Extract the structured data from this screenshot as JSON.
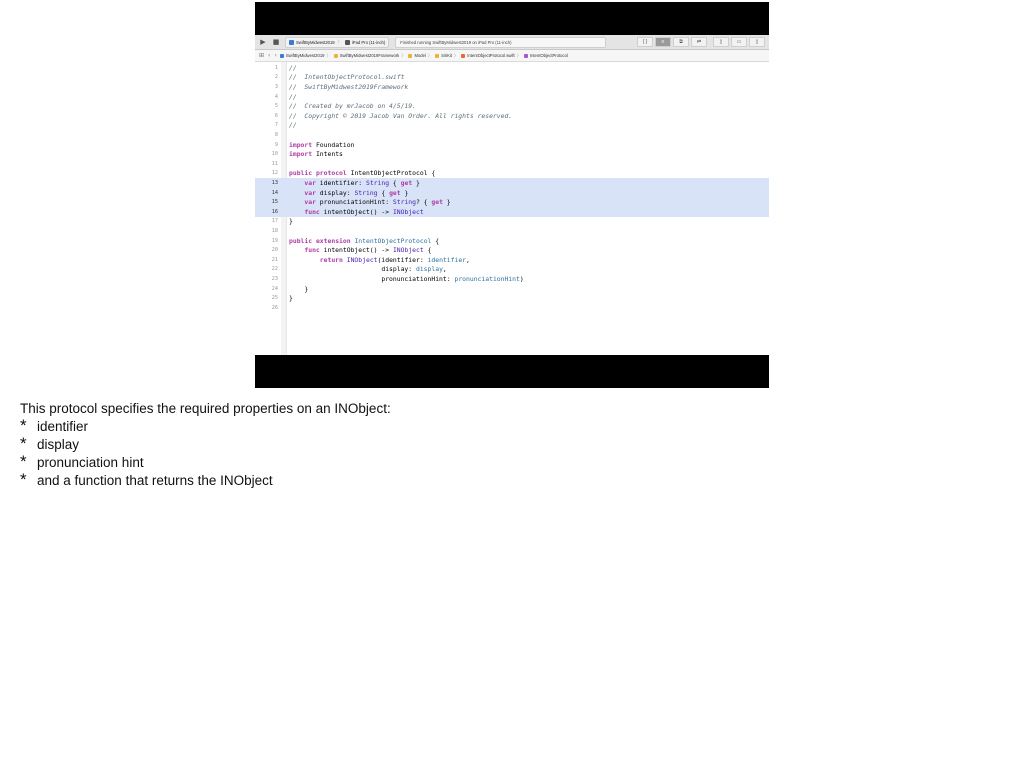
{
  "xcode": {
    "toolbar": {
      "scheme": "SwiftByMidwest2019",
      "destination": "iPad Pro (11-inch)",
      "status": "Finished running SwiftByMidwest2019 on iPad Pro (11-inch)"
    },
    "jumpbar": {
      "crumbs": [
        "SwiftByMidwest2019",
        "SwiftByMidwest2019Framework",
        "Model",
        "SiriKit",
        "IntentObjectProtocol.swift",
        "IntentObjectProtocol"
      ]
    },
    "icons": {
      "run": "play-icon",
      "stop": "stop-icon",
      "back": "chevron-left-icon",
      "forward": "chevron-right-icon",
      "grid": "related-items-icon"
    },
    "colors": {
      "highlight": "#d8e3f8",
      "keyword": "#ad3da4",
      "comment": "#5d6c79",
      "type": "#4b21b0"
    }
  },
  "code": {
    "line_numbers": [
      "1",
      "2",
      "3",
      "4",
      "5",
      "6",
      "7",
      "8",
      "9",
      "10",
      "11",
      "12",
      "13",
      "14",
      "15",
      "16",
      "17",
      "18",
      "19",
      "20",
      "21",
      "22",
      "23",
      "24",
      "25",
      "26"
    ],
    "comments": [
      "//",
      "//  IntentObjectProtocol.swift",
      "//  SwiftByMidwest2019Framework",
      "//",
      "//  Created by mrJacob on 4/5/19.",
      "//  Copyright © 2019 Jacob Van Order. All rights reserved.",
      "//"
    ],
    "kw_import": "import",
    "mod_foundation": "Foundation",
    "mod_intents": "Intents",
    "kw_public": "public",
    "kw_protocol": "protocol",
    "kw_extension": "extension",
    "kw_var": "var",
    "kw_func": "func",
    "kw_return": "return",
    "kw_get": "get",
    "type_protocol": "IntentObjectProtocol",
    "type_string": "String",
    "type_inobject": "INObject",
    "prop_identifier": "identifier",
    "prop_display": "display",
    "prop_hint": "pronunciationHint",
    "fn_name": "intentObject()",
    "arrow": "->",
    "open_brace": "{",
    "close_brace": "}",
    "arg_identifier": "identifier:",
    "arg_display": "display:",
    "arg_hint": "pronunciationHint:"
  },
  "caption": {
    "intro": "This protocol specifies the required properties on an INObject:",
    "bullet_symbol": "*",
    "bullets": [
      "identifier",
      "display",
      "pronunciation hint",
      "and a function that returns the INObject"
    ]
  }
}
